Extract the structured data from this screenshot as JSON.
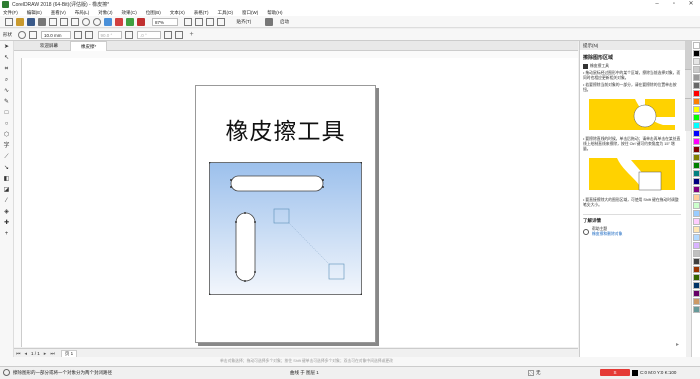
{
  "window": {
    "title": "CorelDRAW 2018 (64-Bit)(评估版) - 橡皮擦*"
  },
  "menu": [
    "文件(F)",
    "编辑(E)",
    "查看(V)",
    "布局(L)",
    "对象(J)",
    "效果(C)",
    "位图(B)",
    "文本(X)",
    "表格(T)",
    "工具(O)",
    "窗口(W)",
    "帮助(H)"
  ],
  "std_toolbar": {
    "zoom": "87%",
    "snap": "贴齐(T)",
    "launch": "启动"
  },
  "prop_toolbar": {
    "label": "形状",
    "width_value": "10.0 mm",
    "angle1": "90.0 °",
    "angle2": ".0 °"
  },
  "tabs": [
    {
      "label": "欢迎屏幕"
    },
    {
      "label": "橡皮擦*"
    }
  ],
  "canvas": {
    "heading": "橡皮擦工具"
  },
  "docker": {
    "title": "提示(N)",
    "section_title": "擦除图形区域",
    "tool_name": "橡皮擦工具",
    "bullet1": "• 拖动鼠标经过图形中的某个区域，擦除当前选择对象，而同时也相应更新相关对象。",
    "bullet2": "• 若要擦除当前对象的一部分，请在要擦除的位置单击按钮。",
    "bullet3": "• 要擦除直线的时候，单击后拖动；请单击再单击在某处直线上绘制直线来擦除，按住 Ctrl 键可约束角度为 15° 增量。",
    "bullet4": "• 要直接擦除大的图形区域，可使用 Shift 键在拖动时调整笔尖大小。",
    "learn_more": "了解详情",
    "help_topic": "帮助主题",
    "help_link": "橡皮擦和删除对象"
  },
  "page_nav": {
    "current": "1 / 1",
    "page_label": "页 1"
  },
  "hint": "单击对象选择；拖动可选择多个对象；按住 Shift 键单击可选择多个对象；双击可在对象中间选择或更改",
  "status": {
    "left": "擦除图形的一部分或将一个对象分为两个封闭路径",
    "stroke": "曲线 于 图层 1",
    "fill_label": "无",
    "color_readout": "C:0 M:0 Y:0 K:100"
  },
  "colors": {
    "accent_yellow": "#ffd200",
    "blue_gradient_top": "#9cc0ec",
    "blue_gradient_bottom": "#f2f6fc"
  },
  "palette": [
    "#ffffff",
    "#000000",
    "#e6e6e6",
    "#cccccc",
    "#999999",
    "#666666",
    "#ff0000",
    "#ff8000",
    "#ffff00",
    "#00ff00",
    "#00ffff",
    "#0000ff",
    "#ff00ff",
    "#800000",
    "#808000",
    "#008000",
    "#008080",
    "#000080",
    "#800080",
    "#ffcc99",
    "#ccffcc",
    "#99ccff",
    "#ffccff",
    "#ffe6b3",
    "#b3d9ff",
    "#d9b3ff",
    "#c0c0c0",
    "#404040",
    "#993300",
    "#336600",
    "#003366",
    "#660066",
    "#cc9966",
    "#669999"
  ]
}
